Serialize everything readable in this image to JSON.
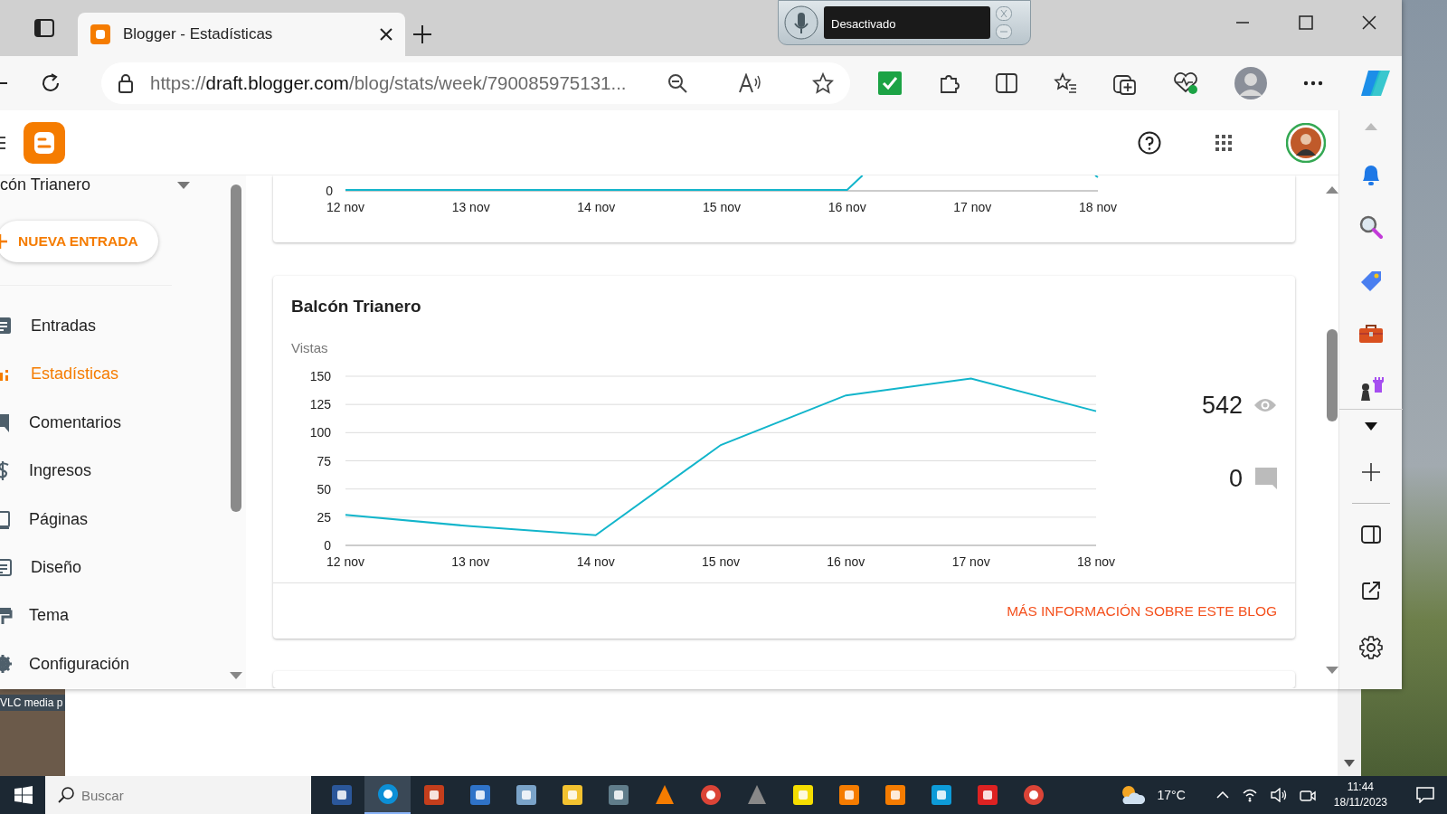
{
  "browser": {
    "tab": {
      "title": "Blogger - Estadísticas",
      "selected": true
    },
    "url_parts": [
      "https://",
      "draft.blogger.com",
      "/blog/stats/week/790085975131..."
    ],
    "voice_widget": {
      "status": "Desactivado"
    }
  },
  "sidebar": {
    "blog_name": "cón Trianero",
    "new_post_button": "NUEVA ENTRADA",
    "items": [
      {
        "label": "Entradas",
        "selected": false
      },
      {
        "label": "Estadísticas",
        "selected": true
      },
      {
        "label": "Comentarios",
        "selected": false
      },
      {
        "label": "Ingresos",
        "selected": false
      },
      {
        "label": "Páginas",
        "selected": false
      },
      {
        "label": "Diseño",
        "selected": false
      },
      {
        "label": "Tema",
        "selected": false
      },
      {
        "label": "Configuración",
        "selected": false
      }
    ]
  },
  "previous_chart": {
    "y_tick": "0",
    "x_labels": [
      "12 nov",
      "13 nov",
      "14 nov",
      "15 nov",
      "16 nov",
      "17 nov",
      "18 nov"
    ]
  },
  "blog_card": {
    "title": "Balcón Trianero",
    "views": "542",
    "comments": "0",
    "link": "MÁS INFORMACIÓN SOBRE ESTE BLOG",
    "chart_data": {
      "type": "line",
      "ylabel": "Vistas",
      "categories": [
        "12 nov",
        "13 nov",
        "14 nov",
        "15 nov",
        "16 nov",
        "17 nov",
        "18 nov"
      ],
      "series": [
        {
          "color": "#12b5cb",
          "values": [
            27,
            17,
            9,
            89,
            133,
            148,
            119
          ]
        }
      ],
      "grid": true,
      "ylim": [
        0,
        150
      ],
      "yticks": [
        0,
        25,
        50,
        75,
        100,
        125,
        150
      ]
    }
  },
  "desktop": {
    "icon_label": "VLC media p"
  },
  "taskbar": {
    "search_placeholder": "Buscar",
    "temperature": "17°C",
    "time": "11:44",
    "date": "18/11/2023"
  }
}
